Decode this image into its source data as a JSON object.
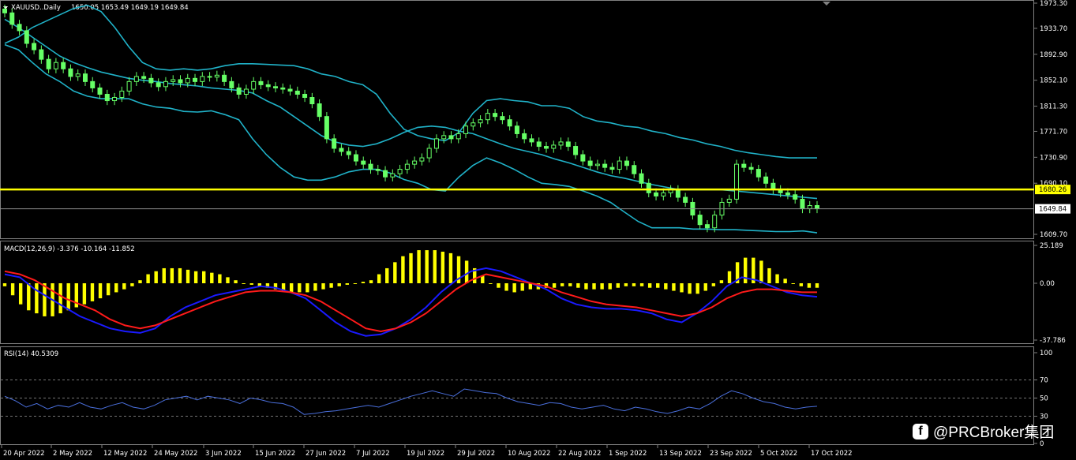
{
  "main_header": {
    "symbol": "XAUUSD..Daily",
    "ohlc": "1650.05 1653.49 1649.19 1649.84"
  },
  "price_axis": {
    "ticks": [
      "1973.30",
      "1933.70",
      "1892.90",
      "1852.10",
      "1811.30",
      "1771.70",
      "1730.90",
      "1690.10",
      "1649.84",
      "1609.70"
    ],
    "tick_values": [
      1973.3,
      1933.7,
      1892.9,
      1852.1,
      1811.3,
      1771.7,
      1730.9,
      1690.1,
      1649.84,
      1609.7
    ],
    "current_price": "1649.84",
    "hline_price": "1680.26"
  },
  "macd": {
    "header": "MACD(12,26,9) -3.376 -10.164 -11.852",
    "ticks": [
      "25.189",
      "0.00",
      "-37.786"
    ],
    "tick_values": [
      25.189,
      0,
      -37.786
    ]
  },
  "rsi": {
    "header": "RSI(14) 40.5309",
    "ticks": [
      "100",
      "70",
      "50",
      "30",
      "0"
    ],
    "tick_values": [
      100,
      70,
      50,
      30,
      0
    ]
  },
  "date_axis": [
    "20 Apr 2022",
    "2 May 2022",
    "12 May 2022",
    "24 May 2022",
    "3 Jun 2022",
    "15 Jun 2022",
    "27 Jun 2022",
    "7 Jul 2022",
    "19 Jul 2022",
    "29 Jul 2022",
    "10 Aug 2022",
    "22 Aug 2022",
    "1 Sep 2022",
    "13 Sep 2022",
    "23 Sep 2022",
    "5 Oct 2022",
    "17 Oct 2022"
  ],
  "watermark": {
    "text": "@PRCBroker集团",
    "icon": "facebook-icon"
  },
  "colors": {
    "candle": "#66ff66",
    "bollinger": "#20b2c8",
    "hline": "#ffff00",
    "macd_hist": "#ffff00",
    "macd_line": "#1a1aff",
    "signal_line": "#ff1a1a",
    "rsi_line": "#4a6fdc",
    "grid": "#808080"
  },
  "chart_data": {
    "type": "line",
    "candles_close": [
      1958,
      1940,
      1930,
      1910,
      1900,
      1885,
      1870,
      1880,
      1870,
      1858,
      1862,
      1850,
      1840,
      1830,
      1820,
      1825,
      1835,
      1850,
      1858,
      1855,
      1848,
      1842,
      1850,
      1853,
      1848,
      1855,
      1850,
      1858,
      1857,
      1860,
      1850,
      1840,
      1830,
      1838,
      1850,
      1845,
      1842,
      1840,
      1838,
      1835,
      1830,
      1825,
      1815,
      1795,
      1760,
      1745,
      1740,
      1735,
      1725,
      1720,
      1712,
      1710,
      1700,
      1705,
      1712,
      1720,
      1725,
      1730,
      1745,
      1760,
      1765,
      1760,
      1768,
      1780,
      1785,
      1790,
      1800,
      1795,
      1790,
      1780,
      1768,
      1760,
      1755,
      1748,
      1745,
      1750,
      1755,
      1748,
      1735,
      1725,
      1718,
      1720,
      1715,
      1712,
      1725,
      1718,
      1705,
      1690,
      1675,
      1670,
      1675,
      1680,
      1668,
      1660,
      1640,
      1625,
      1620,
      1640,
      1660,
      1665,
      1720,
      1715,
      1712,
      1700,
      1690,
      1680,
      1675,
      1672,
      1665,
      1650,
      1655,
      1650
    ],
    "upper_band": [
      1910,
      1920,
      1935,
      1945,
      1955,
      1965,
      1970,
      1960,
      1935,
      1905,
      1880,
      1870,
      1868,
      1870,
      1868,
      1870,
      1875,
      1878,
      1878,
      1877,
      1876,
      1875,
      1870,
      1862,
      1858,
      1850,
      1845,
      1830,
      1800,
      1775,
      1765,
      1760,
      1757,
      1770,
      1800,
      1820,
      1823,
      1820,
      1818,
      1812,
      1812,
      1808,
      1795,
      1788,
      1785,
      1780,
      1778,
      1772,
      1768,
      1762,
      1758,
      1752,
      1748,
      1742,
      1738,
      1735,
      1732,
      1730,
      1730,
      1730
    ],
    "middle_band": [
      1948,
      1935,
      1920,
      1905,
      1890,
      1880,
      1872,
      1865,
      1860,
      1855,
      1852,
      1850,
      1847,
      1845,
      1843,
      1840,
      1838,
      1836,
      1832,
      1820,
      1810,
      1795,
      1780,
      1765,
      1755,
      1750,
      1748,
      1752,
      1760,
      1770,
      1778,
      1780,
      1778,
      1772,
      1768,
      1760,
      1752,
      1745,
      1740,
      1735,
      1728,
      1722,
      1715,
      1708,
      1702,
      1698,
      1693,
      1688,
      1684,
      1680,
      1680,
      1680,
      1680,
      1678,
      1676,
      1674,
      1672,
      1670,
      1668,
      1666
    ],
    "lower_band": [
      1908,
      1900,
      1880,
      1862,
      1850,
      1835,
      1827,
      1823,
      1823,
      1823,
      1815,
      1810,
      1808,
      1803,
      1802,
      1804,
      1798,
      1790,
      1760,
      1735,
      1715,
      1700,
      1695,
      1695,
      1700,
      1708,
      1712,
      1712,
      1706,
      1696,
      1690,
      1680,
      1678,
      1700,
      1718,
      1730,
      1722,
      1712,
      1700,
      1690,
      1688,
      1685,
      1678,
      1670,
      1660,
      1645,
      1630,
      1620,
      1620,
      1620,
      1618,
      1618,
      1617,
      1617,
      1616,
      1615,
      1614,
      1614,
      1615,
      1612
    ],
    "macd_hist": [
      -2,
      -8,
      -14,
      -18,
      -20,
      -22,
      -22,
      -20,
      -18,
      -16,
      -14,
      -12,
      -10,
      -8,
      -6,
      -4,
      -2,
      2,
      6,
      8,
      10,
      10,
      10,
      9,
      8,
      8,
      7,
      6,
      4,
      2,
      0,
      -1,
      -2,
      -3,
      -4,
      -5,
      -6,
      -6,
      -6,
      -5,
      -4,
      -3,
      -2,
      -1,
      0,
      1,
      2,
      6,
      10,
      14,
      18,
      20,
      22,
      22,
      22,
      21,
      20,
      18,
      15,
      10,
      5,
      0,
      -3,
      -5,
      -6,
      -5,
      -4,
      -4,
      -3,
      -3,
      -2,
      -2,
      -3,
      -4,
      -4,
      -4,
      -4,
      -3,
      -2,
      -2,
      -2,
      -3,
      -3,
      -4,
      -5,
      -6,
      -7,
      -7,
      -5,
      -2,
      2,
      8,
      14,
      17,
      17,
      15,
      10,
      6,
      3,
      0,
      -2,
      -3,
      -3
    ],
    "macd_line": [
      6,
      4,
      -4,
      -10,
      -16,
      -22,
      -26,
      -30,
      -32,
      -33,
      -30,
      -22,
      -16,
      -12,
      -8,
      -6,
      -4,
      -2,
      -3,
      -6,
      -10,
      -18,
      -26,
      -32,
      -35,
      -34,
      -30,
      -24,
      -16,
      -6,
      2,
      8,
      10,
      8,
      4,
      0,
      -4,
      -10,
      -14,
      -16,
      -17,
      -17,
      -18,
      -20,
      -24,
      -26,
      -20,
      -12,
      -2,
      4,
      2,
      -2,
      -6,
      -8,
      -9
    ],
    "signal_line": [
      8,
      6,
      2,
      -4,
      -10,
      -14,
      -18,
      -24,
      -28,
      -30,
      -28,
      -24,
      -20,
      -16,
      -12,
      -9,
      -6,
      -5,
      -5,
      -6,
      -8,
      -12,
      -18,
      -24,
      -30,
      -32,
      -30,
      -26,
      -20,
      -12,
      -4,
      2,
      6,
      4,
      2,
      0,
      -2,
      -6,
      -9,
      -12,
      -14,
      -15,
      -16,
      -18,
      -20,
      -22,
      -20,
      -16,
      -10,
      -6,
      -4,
      -4,
      -5,
      -6,
      -6
    ],
    "rsi": [
      52,
      47,
      40,
      44,
      38,
      42,
      40,
      45,
      40,
      38,
      42,
      45,
      40,
      38,
      42,
      48,
      50,
      52,
      48,
      52,
      50,
      48,
      44,
      50,
      48,
      45,
      44,
      40,
      32,
      33,
      35,
      36,
      38,
      40,
      42,
      40,
      44,
      48,
      52,
      55,
      58,
      55,
      52,
      60,
      58,
      56,
      55,
      50,
      46,
      44,
      42,
      45,
      44,
      40,
      38,
      40,
      42,
      38,
      36,
      40,
      38,
      35,
      33,
      36,
      40,
      38,
      44,
      52,
      58,
      55,
      50,
      46,
      44,
      40,
      38,
      40,
      41
    ]
  }
}
